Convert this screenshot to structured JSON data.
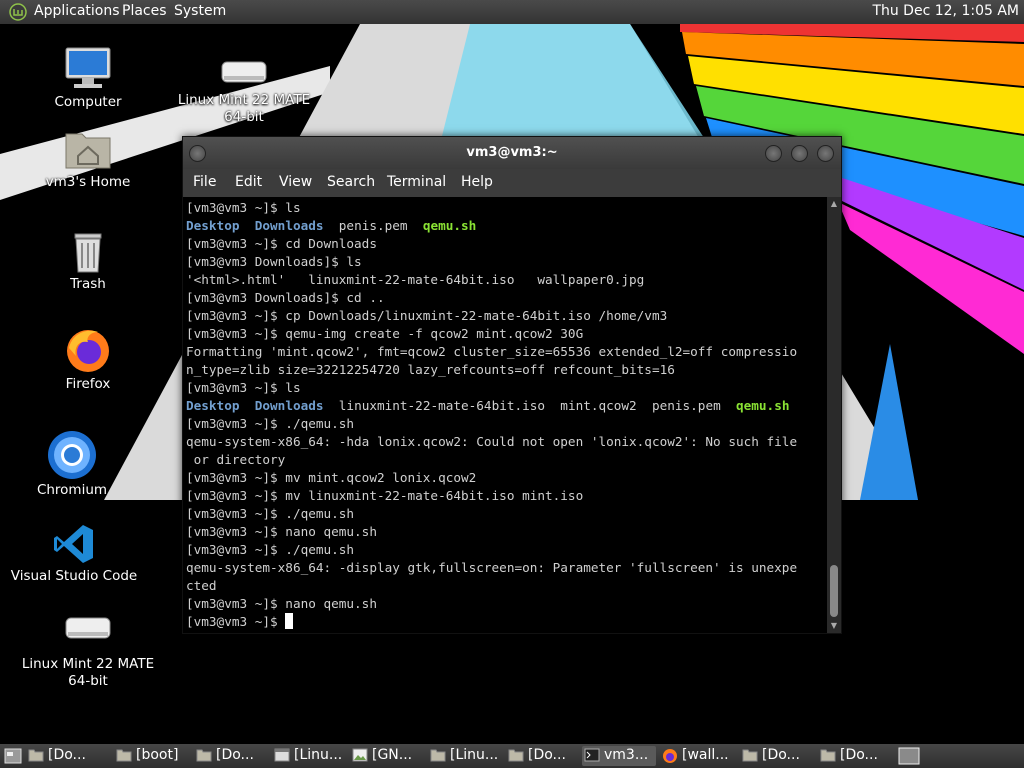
{
  "top_panel": {
    "menus": [
      "Applications",
      "Places",
      "System"
    ],
    "clock": "Thu Dec 12,  1:05 AM"
  },
  "desktop_icons": [
    {
      "label": "Computer",
      "icon": "computer-icon"
    },
    {
      "label": "Linux Mint 22 MATE 64-bit",
      "icon": "drive-icon"
    },
    {
      "label": "vm3's Home",
      "icon": "home-folder-icon"
    },
    {
      "label": "Trash",
      "icon": "trash-icon"
    },
    {
      "label": "Firefox",
      "icon": "firefox-icon"
    },
    {
      "label": "Chromium",
      "icon": "chromium-icon"
    },
    {
      "label": "Visual Studio Code",
      "icon": "vscode-icon"
    },
    {
      "label": "Linux Mint 22 MATE 64-bit",
      "icon": "drive-icon"
    }
  ],
  "terminal": {
    "title": "vm3@vm3:~",
    "menus": [
      "File",
      "Edit",
      "View",
      "Search",
      "Terminal",
      "Help"
    ],
    "lines": [
      [
        {
          "t": "[vm3@vm3 ~]$ ls"
        }
      ],
      [
        {
          "t": "Desktop",
          "c": "dir"
        },
        {
          "t": "  "
        },
        {
          "t": "Downloads",
          "c": "dir"
        },
        {
          "t": "  penis.pem  "
        },
        {
          "t": "qemu.sh",
          "c": "exe"
        }
      ],
      [
        {
          "t": "[vm3@vm3 ~]$ cd Downloads"
        }
      ],
      [
        {
          "t": "[vm3@vm3 Downloads]$ ls"
        }
      ],
      [
        {
          "t": "'<html>.html'   linuxmint-22-mate-64bit.iso   wallpaper0.jpg"
        }
      ],
      [
        {
          "t": "[vm3@vm3 Downloads]$ cd .."
        }
      ],
      [
        {
          "t": "[vm3@vm3 ~]$ cp Downloads/linuxmint-22-mate-64bit.iso /home/vm3"
        }
      ],
      [
        {
          "t": "[vm3@vm3 ~]$ qemu-img create -f qcow2 mint.qcow2 30G"
        }
      ],
      [
        {
          "t": "Formatting 'mint.qcow2', fmt=qcow2 cluster_size=65536 extended_l2=off compressio"
        }
      ],
      [
        {
          "t": "n_type=zlib size=32212254720 lazy_refcounts=off refcount_bits=16"
        }
      ],
      [
        {
          "t": "[vm3@vm3 ~]$ ls"
        }
      ],
      [
        {
          "t": "Desktop",
          "c": "dir"
        },
        {
          "t": "  "
        },
        {
          "t": "Downloads",
          "c": "dir"
        },
        {
          "t": "  linuxmint-22-mate-64bit.iso  mint.qcow2  penis.pem  "
        },
        {
          "t": "qemu.sh",
          "c": "exe"
        }
      ],
      [
        {
          "t": "[vm3@vm3 ~]$ ./qemu.sh"
        }
      ],
      [
        {
          "t": "qemu-system-x86_64: -hda lonix.qcow2: Could not open 'lonix.qcow2': No such file"
        }
      ],
      [
        {
          "t": " or directory"
        }
      ],
      [
        {
          "t": "[vm3@vm3 ~]$ mv mint.qcow2 lonix.qcow2"
        }
      ],
      [
        {
          "t": "[vm3@vm3 ~]$ mv linuxmint-22-mate-64bit.iso mint.iso"
        }
      ],
      [
        {
          "t": "[vm3@vm3 ~]$ ./qemu.sh"
        }
      ],
      [
        {
          "t": "[vm3@vm3 ~]$ nano qemu.sh"
        }
      ],
      [
        {
          "t": "[vm3@vm3 ~]$ ./qemu.sh"
        }
      ],
      [
        {
          "t": "qemu-system-x86_64: -display gtk,fullscreen=on: Parameter 'fullscreen' is unexpe"
        }
      ],
      [
        {
          "t": "cted"
        }
      ],
      [
        {
          "t": "[vm3@vm3 ~]$ nano qemu.sh"
        }
      ],
      [
        {
          "t": "[vm3@vm3 ~]$ "
        }
      ]
    ]
  },
  "taskbar": [
    {
      "label": "[Do...",
      "icon": "folder-icon"
    },
    {
      "label": "[boot]",
      "icon": "folder-icon"
    },
    {
      "label": "[Do...",
      "icon": "folder-icon"
    },
    {
      "label": "[Linu...",
      "icon": "window-icon"
    },
    {
      "label": "[GN...",
      "icon": "image-icon"
    },
    {
      "label": "[Linu...",
      "icon": "folder-icon"
    },
    {
      "label": "[Do...",
      "icon": "folder-icon"
    },
    {
      "label": "vm3...",
      "icon": "terminal-icon",
      "active": true
    },
    {
      "label": "[wall...",
      "icon": "firefox-icon"
    },
    {
      "label": "[Do...",
      "icon": "folder-icon"
    },
    {
      "label": "[Do...",
      "icon": "folder-icon"
    }
  ],
  "colors": {
    "dir": "#729fcf",
    "exe": "#8ae234",
    "terminal_bg": "#000000",
    "panel": "#3a3a3a"
  }
}
